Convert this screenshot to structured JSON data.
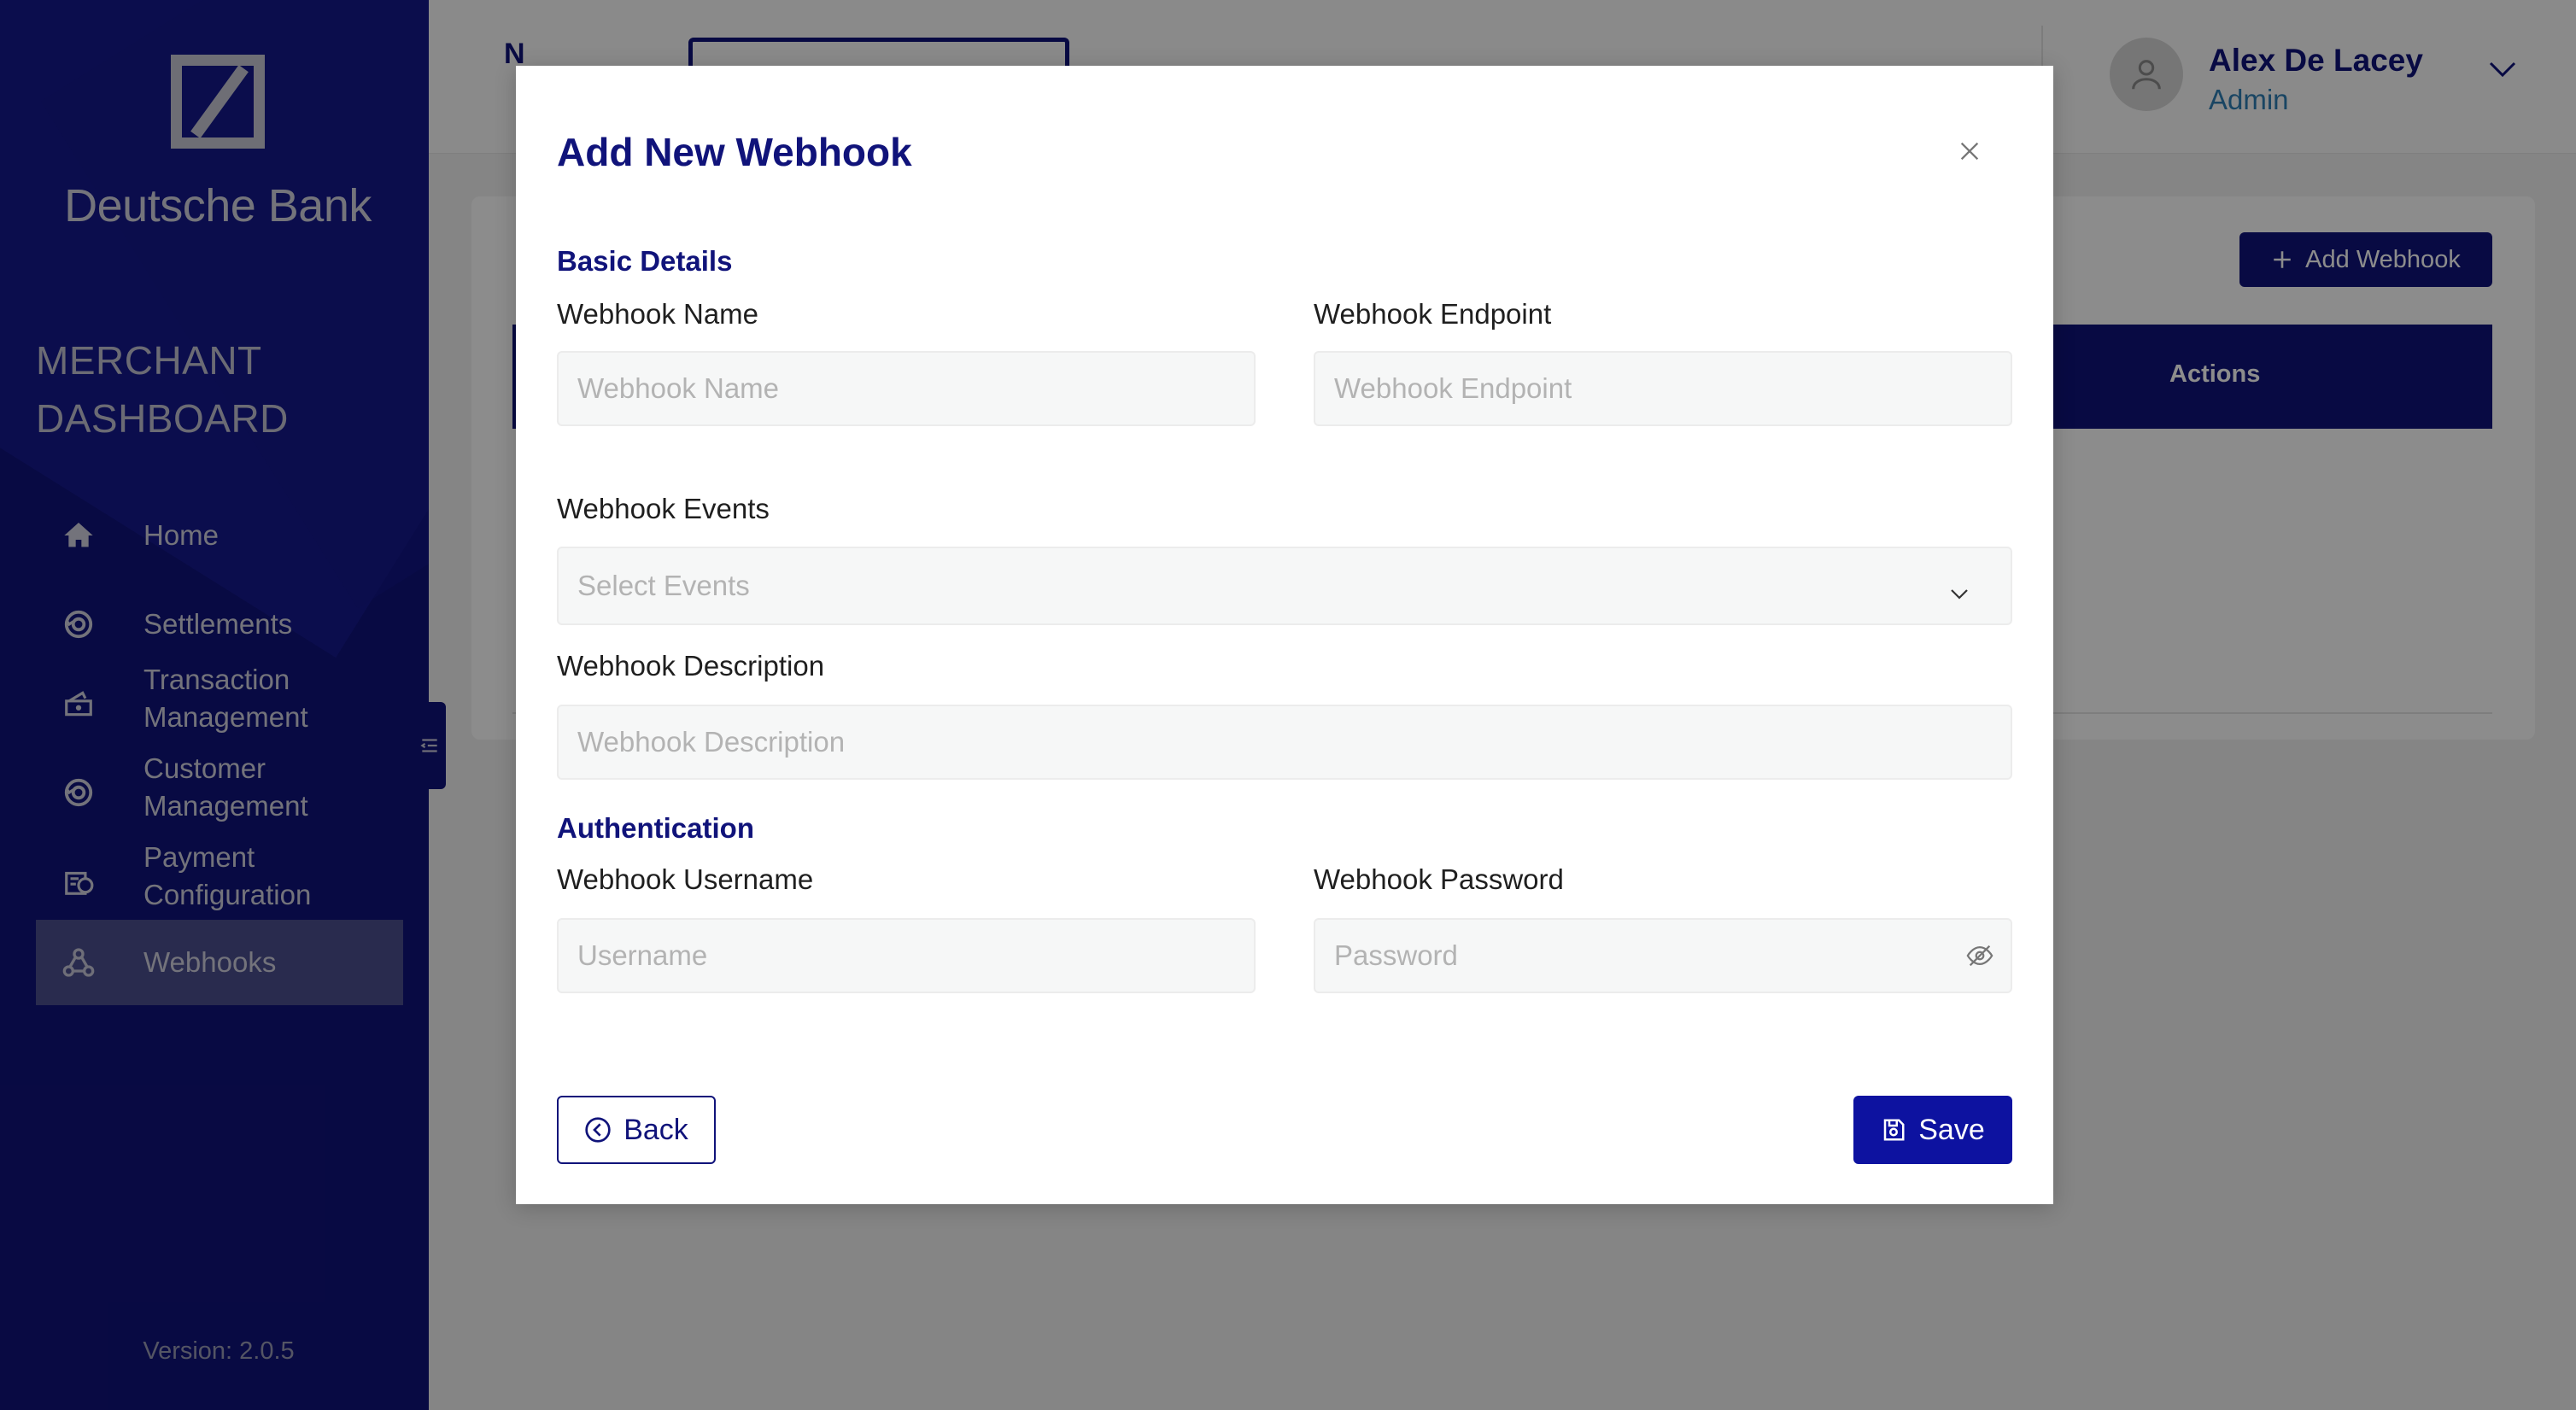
{
  "sidebar": {
    "brand": "Deutsche Bank",
    "dashboard_title_line1": "MERCHANT",
    "dashboard_title_line2": "DASHBOARD",
    "items": [
      {
        "label": "Home",
        "icon": "home-icon"
      },
      {
        "label": "Settlements",
        "icon": "settlements-icon"
      },
      {
        "label": "Transaction Management",
        "icon": "transaction-icon"
      },
      {
        "label": "Customer Management",
        "icon": "customer-icon"
      },
      {
        "label": "Payment Configuration",
        "icon": "payment-config-icon"
      },
      {
        "label": "Webhooks",
        "icon": "webhooks-icon",
        "active": true
      }
    ],
    "version": "Version: 2.0.5"
  },
  "header": {
    "tab_partial": "N",
    "user": {
      "name": "Alex De Lacey",
      "role": "Admin"
    }
  },
  "page": {
    "add_webhook_label": "Add Webhook",
    "table_actions_header": "Actions"
  },
  "modal": {
    "title": "Add New Webhook",
    "basic_details": "Basic Details",
    "authentication": "Authentication",
    "fields": {
      "name": {
        "label": "Webhook Name",
        "placeholder": "Webhook Name",
        "value": ""
      },
      "endpoint": {
        "label": "Webhook Endpoint",
        "placeholder": "Webhook Endpoint",
        "value": ""
      },
      "events": {
        "label": "Webhook Events",
        "placeholder": "Select Events"
      },
      "description": {
        "label": "Webhook Description",
        "placeholder": "Webhook Description",
        "value": ""
      },
      "username": {
        "label": "Webhook Username",
        "placeholder": "Username",
        "value": ""
      },
      "password": {
        "label": "Webhook Password",
        "placeholder": "Password",
        "value": ""
      }
    },
    "back_label": "Back",
    "save_label": "Save"
  },
  "colors": {
    "brand_navy": "#10137a",
    "save_blue": "#0d12a0",
    "role_blue": "#2f7fb4"
  }
}
